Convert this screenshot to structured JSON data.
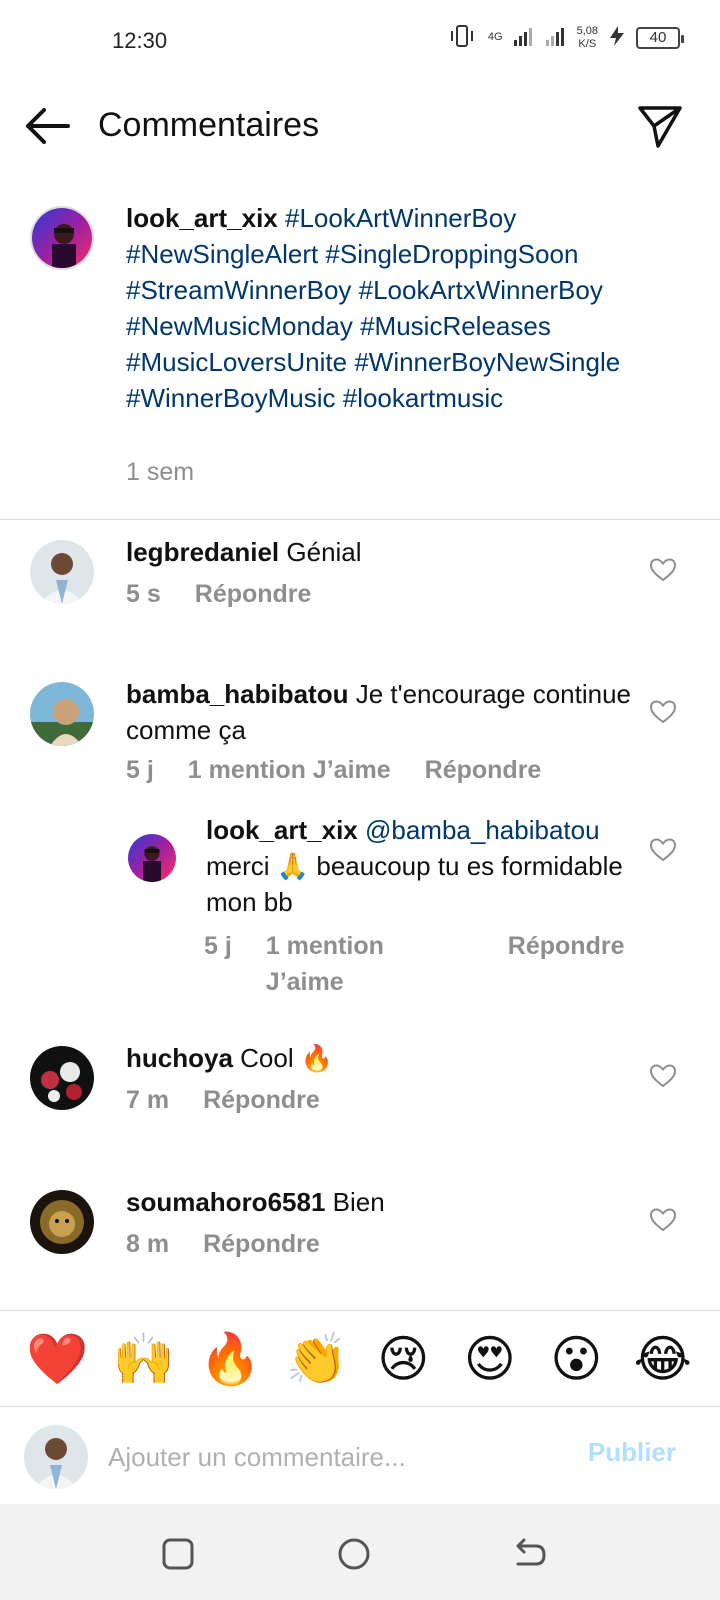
{
  "status_bar": {
    "time": "12:30",
    "network_top": "4G",
    "speed_value": "5,08",
    "speed_unit": "K/S",
    "battery": "40"
  },
  "header": {
    "title": "Commentaires"
  },
  "caption": {
    "username": "look_art_xix",
    "text": "#LookArtWinnerBoy #NewSingleAlert #SingleDroppingSoon #StreamWinnerBoy #LookArtxWinnerBoy #NewMusicMonday #MusicReleases #MusicLoversUnite #WinnerBoyNewSingle #WinnerBoyMusic #lookartmusic",
    "time": "1 sem"
  },
  "comments": [
    {
      "username": "legbredaniel",
      "text": "Génial",
      "time": "5 s",
      "reply_label": "Répondre"
    },
    {
      "username": "bamba_habibatou",
      "text": "Je t'encourage continue comme ça",
      "time": "5 j",
      "likes": "1 mention J’aime",
      "reply_label": "Répondre"
    },
    {
      "username": "look_art_xix",
      "mention": "@bamba_habibatou",
      "text": "merci 🙏 beaucoup tu es formidable mon bb",
      "time": "5 j",
      "likes_line1": "1 mention",
      "likes_line2": "J’aime",
      "reply_label": "Répondre"
    },
    {
      "username": "huchoya",
      "text": "Cool 🔥",
      "time": "7 m",
      "reply_label": "Répondre"
    },
    {
      "username": "soumahoro6581",
      "text": "Bien",
      "time": "8 m",
      "reply_label": "Répondre"
    }
  ],
  "emoji_bar": [
    "❤️",
    "🙌",
    "🔥",
    "👏",
    "😢",
    "😍",
    "😮",
    "😂"
  ],
  "input": {
    "placeholder": "Ajouter un commentaire...",
    "publish_label": "Publier"
  },
  "colors": {
    "hashtag": "#00376b",
    "meta": "#8e8e8e",
    "publish": "#b2dffc",
    "divider": "#dbdbdb"
  }
}
